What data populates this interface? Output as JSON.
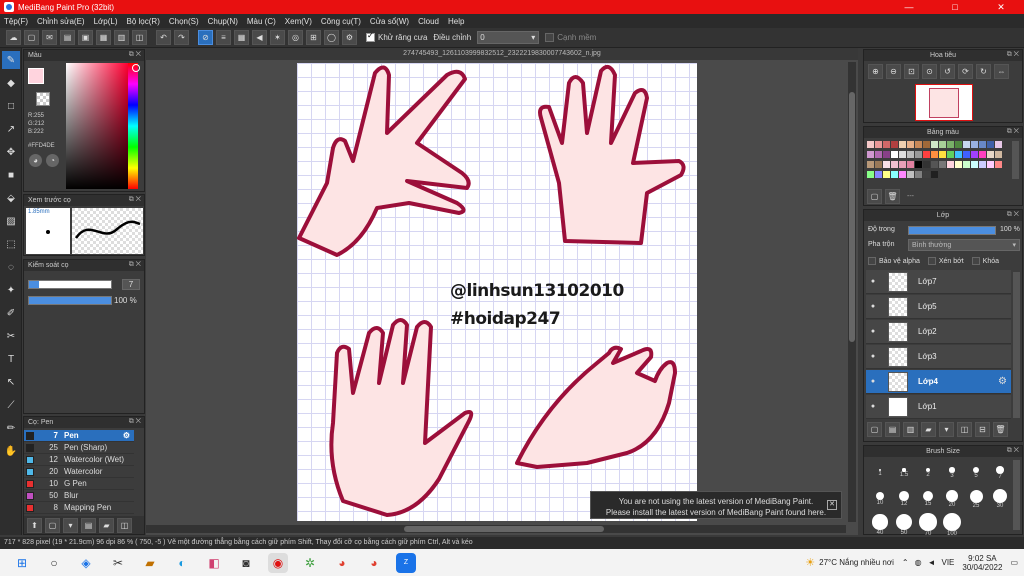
{
  "window": {
    "title": "MediBang Paint Pro (32bit)",
    "min": "—",
    "max": "□",
    "close": "✕"
  },
  "menu": [
    "Tệp(F)",
    "Chỉnh sửa(E)",
    "Lớp(L)",
    "Bộ lọc(R)",
    "Chọn(S)",
    "Chụp(N)",
    "Màu (C)",
    "Xem(V)",
    "Công cụ(T)",
    "Cửa sổ(W)",
    "Cloud",
    "Help"
  ],
  "toolbar": {
    "antialias_label": "Khử răng cưa",
    "adjust_label": "Điều chỉnh",
    "adjust_value": "0",
    "snap_label": "Cạnh mềm"
  },
  "color_panel": {
    "title": "Màu",
    "r": "R:255",
    "g": "G:212",
    "b": "B:222",
    "hex": "#FFD4DE",
    "fg_color": "#FFD4DE"
  },
  "brush_preview": {
    "title": "Xem trước cọ",
    "size": "1.85mm"
  },
  "brush_control": {
    "title": "Kiểm soát cọ",
    "size_value": "7",
    "opacity_value": "100 %"
  },
  "brush_list": {
    "title": "Cọ: Pen",
    "items": [
      {
        "size": "7",
        "name": "Pen",
        "color": "#222222",
        "selected": true
      },
      {
        "size": "25",
        "name": "Pen (Sharp)",
        "color": "#222222",
        "selected": false
      },
      {
        "size": "12",
        "name": "Watercolor (Wet)",
        "color": "#4fb8e8",
        "selected": false
      },
      {
        "size": "20",
        "name": "Watercolor",
        "color": "#4fb8e8",
        "selected": false
      },
      {
        "size": "10",
        "name": "G Pen",
        "color": "#e83030",
        "selected": false
      },
      {
        "size": "50",
        "name": "Blur",
        "color": "#c050c0",
        "selected": false
      },
      {
        "size": "8",
        "name": "Mapping Pen",
        "color": "#e83030",
        "selected": false
      }
    ]
  },
  "canvas": {
    "filename": "274745493_1261103999832512_2322219830007743602_n.jpg",
    "watermark_line1": "@linhsun13102010",
    "watermark_line2": "#hoidap247",
    "notice_line1": "You are not using the latest version of MediBang Paint.",
    "notice_line2": "Please install the latest version of MediBang Paint found here.",
    "notice_close": "✕"
  },
  "navigator": {
    "title": "Hoa tiêu"
  },
  "palette": {
    "title": "Bảng màu",
    "add_label": "---",
    "colors": [
      "#f5c8c8",
      "#e89898",
      "#d06868",
      "#b04040",
      "#f0d0b0",
      "#e8b088",
      "#c88858",
      "#a06838",
      "#d0e8c8",
      "#a8d098",
      "#78b068",
      "#508840",
      "#c8d8f0",
      "#98b0e0",
      "#6888c8",
      "#4060a8",
      "#e8c8e8",
      "#d098d0",
      "#b068b0",
      "#884088",
      "#ffffff",
      "#dddddd",
      "#bbbbbb",
      "#999999",
      "#ff4040",
      "#ff9040",
      "#ffe040",
      "#60d060",
      "#40c0ff",
      "#4060ff",
      "#a040ff",
      "#ff40c0",
      "#e8d8c8",
      "#d0b8a0",
      "#b89878",
      "#987858",
      "#f8e0e8",
      "#f0c0d0",
      "#e8a0b8",
      "#e080a0",
      "#000000",
      "#333333",
      "#555555",
      "#777777",
      "#ffd4de",
      "#ffffcc",
      "#ccffcc",
      "#ccffff",
      "#ccccff",
      "#ffccff",
      "#ff8888",
      "#88ff88",
      "#8888ff",
      "#ffff88",
      "#88ffff",
      "#ff88ff",
      "#c0c0c0",
      "#808080",
      "#404040",
      "#202020"
    ]
  },
  "layers_panel": {
    "title": "Lớp",
    "opacity_label": "Độ trong",
    "opacity_value": "100 %",
    "blend_label": "Pha trộn",
    "blend_value": "Bình thường",
    "protect_alpha": "Bảo vệ alpha",
    "clip": "Xén bớt",
    "lock": "Khóa",
    "layers": [
      {
        "name": "Lớp7",
        "selected": false
      },
      {
        "name": "Lớp5",
        "selected": false
      },
      {
        "name": "Lớp2",
        "selected": false
      },
      {
        "name": "Lớp3",
        "selected": false
      },
      {
        "name": "Lớp4",
        "selected": true
      },
      {
        "name": "Lớp1",
        "selected": false
      }
    ]
  },
  "brush_size": {
    "title": "Brush Size",
    "labels": [
      "1",
      "1.5",
      "2",
      "3",
      "5",
      "7",
      "10",
      "12",
      "15",
      "20",
      "25",
      "30",
      "40",
      "50",
      "70",
      "100"
    ]
  },
  "status": {
    "text": "717 * 828 pixel   (19 * 21.9cm)   96 dpi   86 %   ( 750, -5 )   Vẽ một đường thẳng bằng cách giữ phím Shift, Thay đổi cỡ cọ bằng cách giữ phím Ctrl, Alt và kéo"
  },
  "taskbar": {
    "weather": "27°C  Nắng nhiều nơi",
    "lang": "VIE",
    "time": "9:02 SA",
    "date": "30/04/2022"
  }
}
